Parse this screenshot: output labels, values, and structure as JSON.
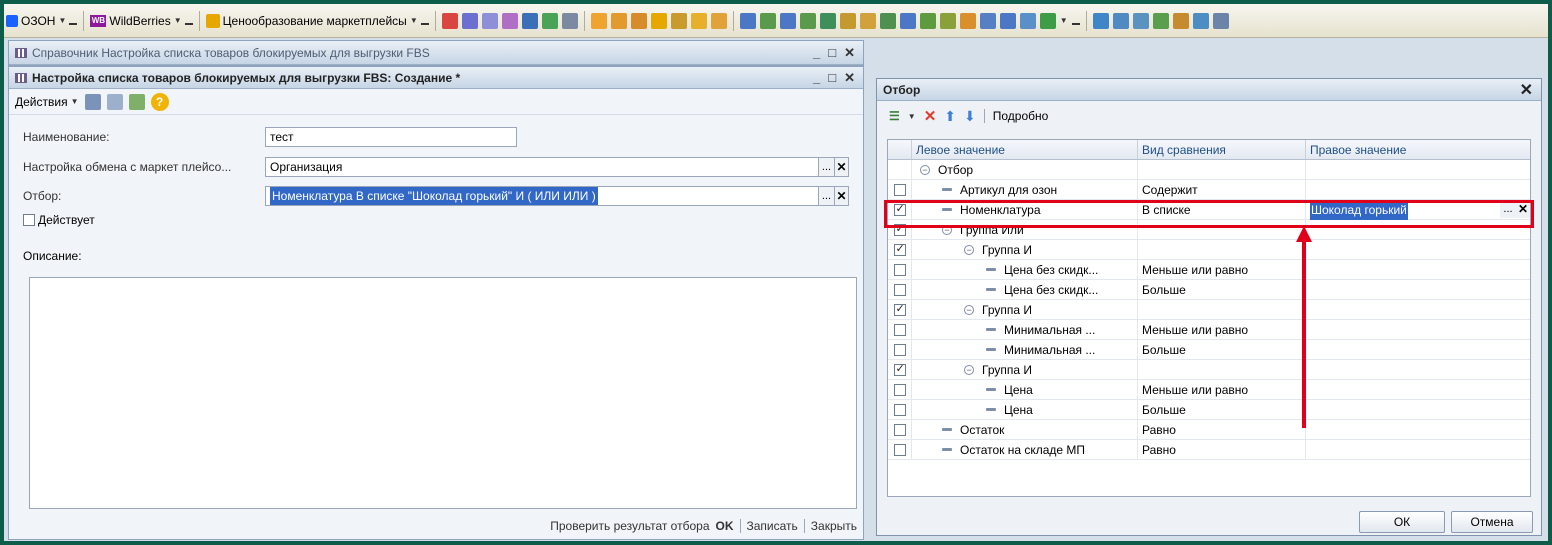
{
  "toolbar": {
    "ozon_label": "ОЗОН",
    "ozon_logo_text": "ozon",
    "wb_label": "WildBerries",
    "wb_logo_text": "WB",
    "pricing_label": "Ценообразование маркетплейсы"
  },
  "window_bg": {
    "title": "Справочник Настройка списка товаров блокируемых для выгрузки FBS"
  },
  "form": {
    "title": "Настройка списка товаров блокируемых для выгрузки FBS: Создание *",
    "actions_label": "Действия",
    "name_label": "Наименование:",
    "name_value": "тест",
    "exchange_label": "Настройка обмена с маркет плейсо...",
    "exchange_value": "Организация",
    "filter_label": "Отбор:",
    "filter_value": "Номенклатура В списке \"Шоколад горький\" И ( ИЛИ ИЛИ )",
    "active_label": "Действует",
    "description_label": "Описание:",
    "check_result_label": "Проверить результат отбора",
    "ok_label": "OK",
    "save_label": "Записать",
    "close_label": "Закрыть"
  },
  "filter_dialog": {
    "title": "Отбор",
    "details_label": "Подробно",
    "columns": [
      "Левое значение",
      "Вид сравнения",
      "Правое значение"
    ],
    "rows": [
      {
        "check": null,
        "kind": "group",
        "indent": 0,
        "left": "Отбор",
        "cmp": "",
        "right": ""
      },
      {
        "check": false,
        "kind": "item",
        "indent": 1,
        "left": "Артикул для озон",
        "cmp": "Содержит",
        "right": ""
      },
      {
        "check": true,
        "kind": "item",
        "indent": 1,
        "left": "Номенклатура",
        "cmp": "В списке",
        "right": "Шоколад горький"
      },
      {
        "check": true,
        "kind": "group",
        "indent": 1,
        "left": "Группа Или",
        "cmp": "",
        "right": ""
      },
      {
        "check": true,
        "kind": "group",
        "indent": 2,
        "left": "Группа И",
        "cmp": "",
        "right": ""
      },
      {
        "check": false,
        "kind": "item",
        "indent": 3,
        "left": "Цена без скидк...",
        "cmp": "Меньше или равно",
        "right": ""
      },
      {
        "check": false,
        "kind": "item",
        "indent": 3,
        "left": "Цена без скидк...",
        "cmp": "Больше",
        "right": ""
      },
      {
        "check": true,
        "kind": "group",
        "indent": 2,
        "left": "Группа И",
        "cmp": "",
        "right": ""
      },
      {
        "check": false,
        "kind": "item",
        "indent": 3,
        "left": "Минимальная ...",
        "cmp": "Меньше или равно",
        "right": ""
      },
      {
        "check": false,
        "kind": "item",
        "indent": 3,
        "left": "Минимальная ...",
        "cmp": "Больше",
        "right": ""
      },
      {
        "check": true,
        "kind": "group",
        "indent": 2,
        "left": "Группа И",
        "cmp": "",
        "right": ""
      },
      {
        "check": false,
        "kind": "item",
        "indent": 3,
        "left": "Цена",
        "cmp": "Меньше или равно",
        "right": ""
      },
      {
        "check": false,
        "kind": "item",
        "indent": 3,
        "left": "Цена",
        "cmp": "Больше",
        "right": ""
      },
      {
        "check": false,
        "kind": "item",
        "indent": 1,
        "left": "Остаток",
        "cmp": "Равно",
        "right": ""
      },
      {
        "check": false,
        "kind": "item",
        "indent": 1,
        "left": "Остаток на складе МП",
        "cmp": "Равно",
        "right": ""
      }
    ],
    "ok_label": "ОК",
    "cancel_label": "Отмена"
  }
}
